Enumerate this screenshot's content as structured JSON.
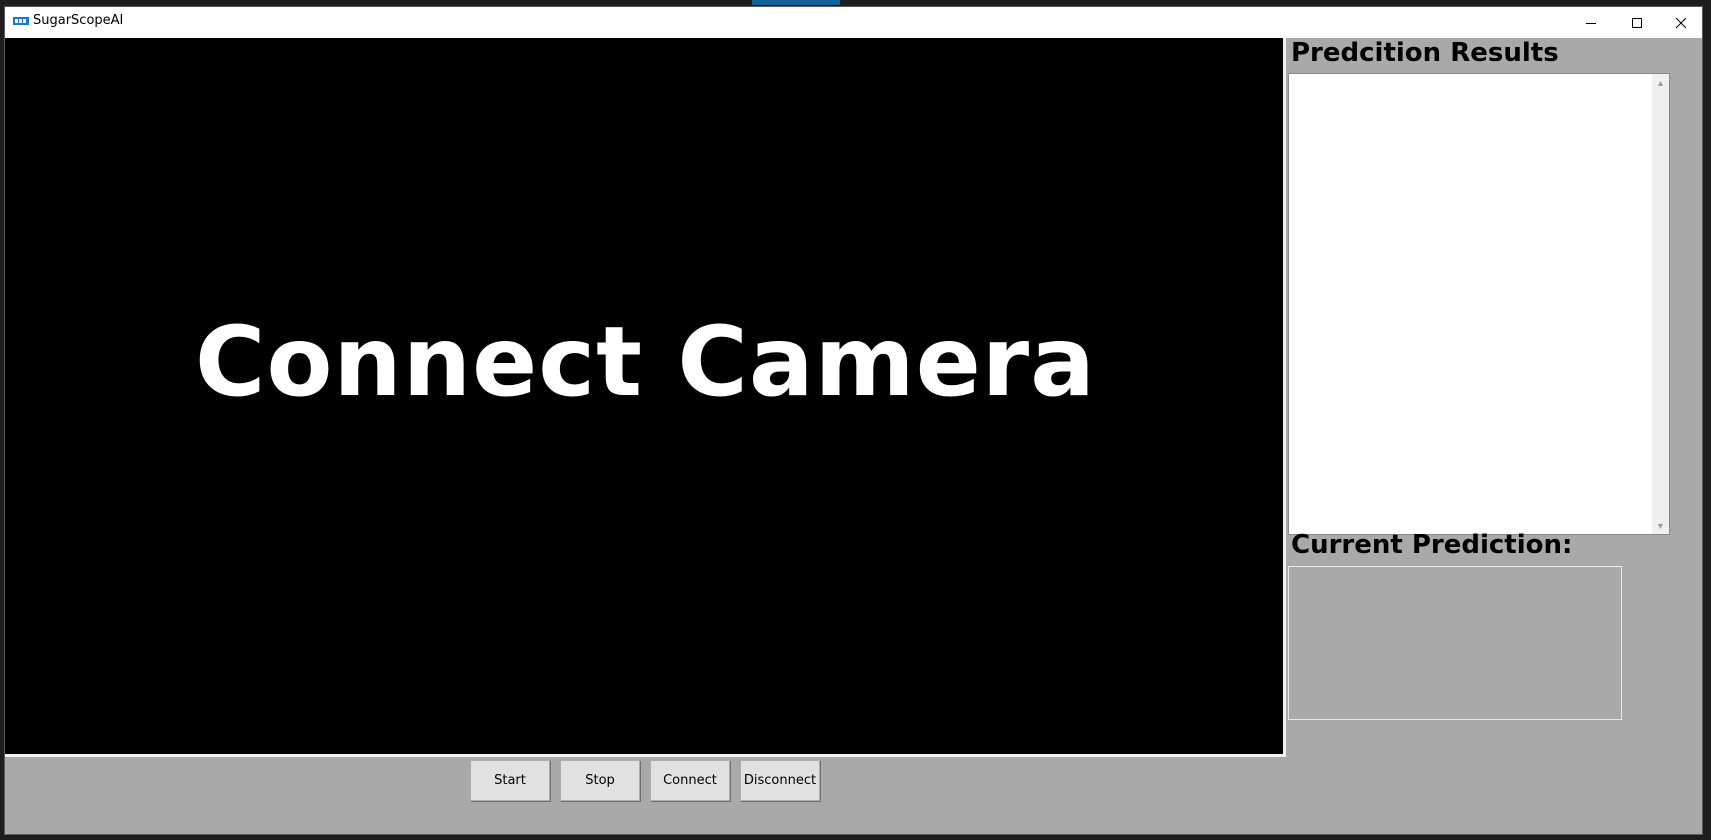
{
  "window": {
    "title": "SugarScopeAI"
  },
  "video": {
    "placeholder_text": "Connect Camera"
  },
  "results_panel": {
    "heading": "Predcition Results"
  },
  "current_panel": {
    "heading": "Current Prediction:"
  },
  "controls": {
    "start_label": "Start",
    "stop_label": "Stop",
    "connect_label": "Connect",
    "disconnect_label": "Disconnect"
  },
  "icons": {
    "app": "app-logo-icon",
    "minimize": "minimize-icon",
    "maximize": "maximize-icon",
    "close": "close-icon"
  },
  "colors": {
    "window_bg": "#a9a9a9",
    "video_bg": "#000000",
    "video_text": "#ffffff",
    "titlebar_bg": "#ffffff"
  }
}
